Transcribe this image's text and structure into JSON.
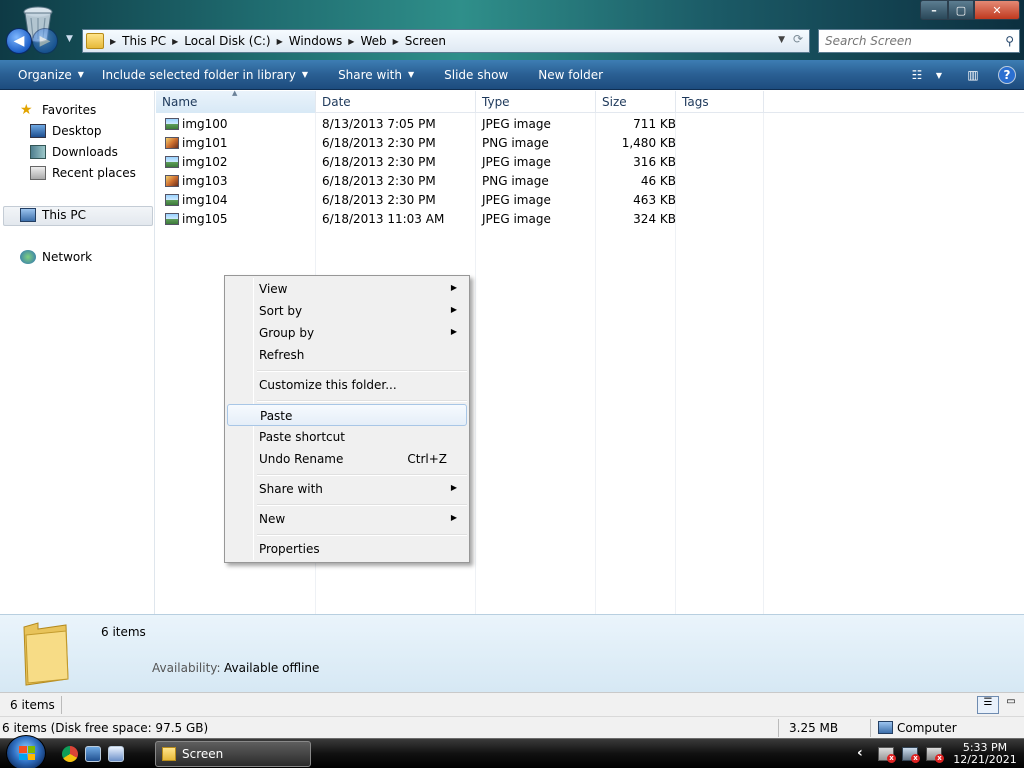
{
  "window": {
    "breadcrumb": [
      "This PC",
      "Local Disk (C:)",
      "Windows",
      "Web",
      "Screen"
    ],
    "search_placeholder": "Search Screen",
    "controls": {
      "minimize": "–",
      "maximize": "▢",
      "close": "✕"
    }
  },
  "toolbar": {
    "organize": "Organize",
    "include_library": "Include selected folder in library",
    "share_with": "Share with",
    "slide_show": "Slide show",
    "new_folder": "New folder"
  },
  "nav": {
    "favorites": "Favorites",
    "desktop": "Desktop",
    "downloads": "Downloads",
    "recent_places": "Recent places",
    "this_pc": "This PC",
    "network": "Network"
  },
  "columns": {
    "name": "Name",
    "date": "Date",
    "type": "Type",
    "size": "Size",
    "tags": "Tags"
  },
  "files": [
    {
      "name": "img100",
      "date": "8/13/2013 7:05 PM",
      "type": "JPEG image",
      "size": "711 KB"
    },
    {
      "name": "img101",
      "date": "6/18/2013 2:30 PM",
      "type": "PNG image",
      "size": "1,480 KB"
    },
    {
      "name": "img102",
      "date": "6/18/2013 2:30 PM",
      "type": "JPEG image",
      "size": "316 KB"
    },
    {
      "name": "img103",
      "date": "6/18/2013 2:30 PM",
      "type": "PNG image",
      "size": "46 KB"
    },
    {
      "name": "img104",
      "date": "6/18/2013 2:30 PM",
      "type": "JPEG image",
      "size": "463 KB"
    },
    {
      "name": "img105",
      "date": "6/18/2013 11:03 AM",
      "type": "JPEG image",
      "size": "324 KB"
    }
  ],
  "context_menu": {
    "view": "View",
    "sort_by": "Sort by",
    "group_by": "Group by",
    "refresh": "Refresh",
    "customize": "Customize this folder...",
    "paste": "Paste",
    "paste_shortcut": "Paste shortcut",
    "undo_rename": "Undo Rename",
    "undo_shortcut": "Ctrl+Z",
    "share_with": "Share with",
    "new": "New",
    "properties": "Properties"
  },
  "details": {
    "count": "6 items",
    "availability_label": "Availability:",
    "availability_value": "Available offline"
  },
  "status": {
    "items": "6 items",
    "disk_info": "6 items (Disk free space: 97.5 GB)",
    "total_size": "3.25 MB",
    "location": "Computer"
  },
  "taskbar": {
    "window_label": "Screen",
    "time": "5:33 PM",
    "date": "12/21/2021"
  }
}
